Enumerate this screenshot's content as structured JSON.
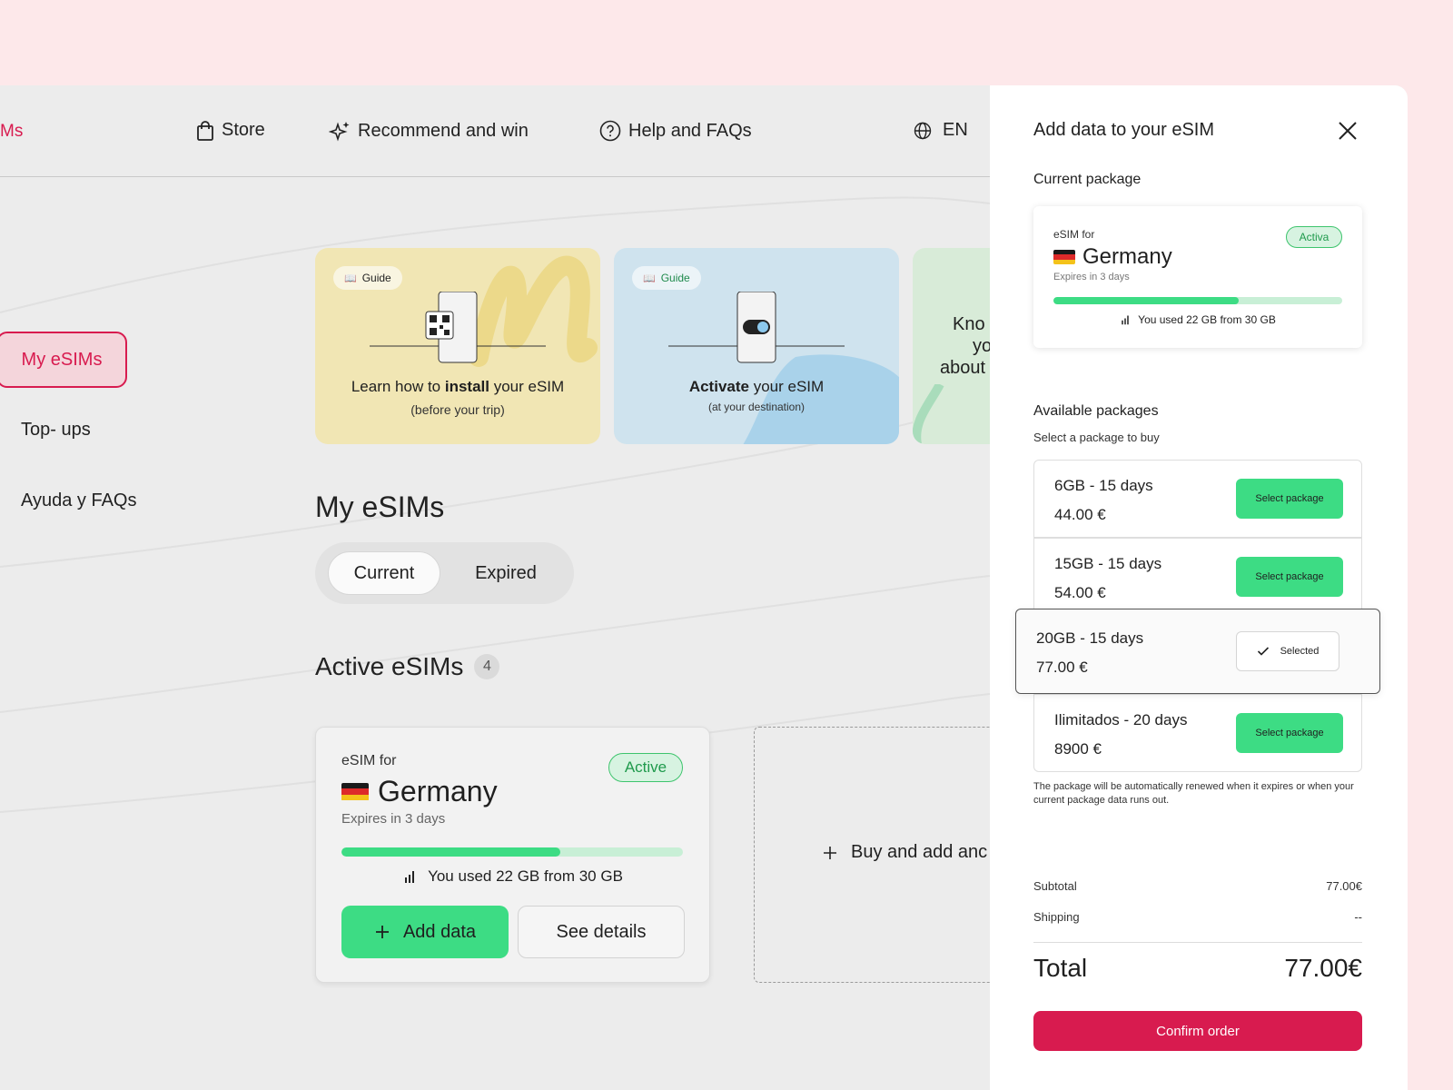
{
  "nav": {
    "logo_fragment": "Ms",
    "store": "Store",
    "recommend": "Recommend and win",
    "help": "Help and FAQs",
    "language": "EN"
  },
  "sidebar": {
    "items": [
      {
        "label": "My eSIMs"
      },
      {
        "label": "Top- ups"
      },
      {
        "label": "Ayuda y FAQs"
      }
    ]
  },
  "guides": [
    {
      "badge": "Guide",
      "line1_pre": "Learn how to ",
      "line1_bold": "install",
      "line1_post": " your eSIM",
      "line2": "(before your trip)",
      "color": "#f1e6b4"
    },
    {
      "badge": "Guide",
      "line1_pre": "",
      "line1_bold": "Activate",
      "line1_post": " your eSIM",
      "line2": "(at your destination)",
      "color": "#cfe3ee"
    },
    {
      "text1": "Kno",
      "text2": "yo",
      "text3": "about",
      "color": "#d8ebd8"
    }
  ],
  "main": {
    "heading": "My eSIMs",
    "tabs": [
      {
        "label": "Current"
      },
      {
        "label": "Expired"
      }
    ],
    "active_heading": "Active eSIMs",
    "active_count": "4",
    "esim_card": {
      "for_label": "eSIM for",
      "country": "Germany",
      "expires": "Expires in 3 days",
      "status": "Active",
      "usage": "You used 22 GB from 30 GB",
      "usage_fraction": 0.64,
      "add_data": "Add data",
      "see_details": "See details"
    },
    "buy_label": "Buy and add anc"
  },
  "panel": {
    "title": "Add data to your eSIM",
    "current_package_label": "Current package",
    "current": {
      "for_label": "eSIM for",
      "country": "Germany",
      "expires": "Expires in 3 days",
      "status": "Activa",
      "usage": "You used 22 GB from 30 GB",
      "usage_fraction": 0.64
    },
    "available_label": "Available packages",
    "available_sub": "Select a package to buy",
    "packages": [
      {
        "name": "6GB - 15 days",
        "price": "44.00 €",
        "button": "Select package"
      },
      {
        "name": "15GB - 15 days",
        "price": "54.00 €",
        "button": "Select package"
      },
      {
        "name": "20GB - 15 days",
        "price": "77.00 €",
        "button": "Selected"
      },
      {
        "name": "Ilimitados - 20 days",
        "price": "8900 €",
        "button": "Select package"
      }
    ],
    "note": "The package will be automatically renewed when it expires or when your current package data runs out.",
    "subtotal_label": "Subtotal",
    "subtotal_value": "77.00€",
    "shipping_label": "Shipping",
    "shipping_value": "--",
    "total_label": "Total",
    "total_value": "77.00€",
    "confirm": "Confirm order"
  },
  "colors": {
    "brand": "#d81b4f",
    "green": "#3ddc84",
    "page_bg": "#fde8ea"
  }
}
